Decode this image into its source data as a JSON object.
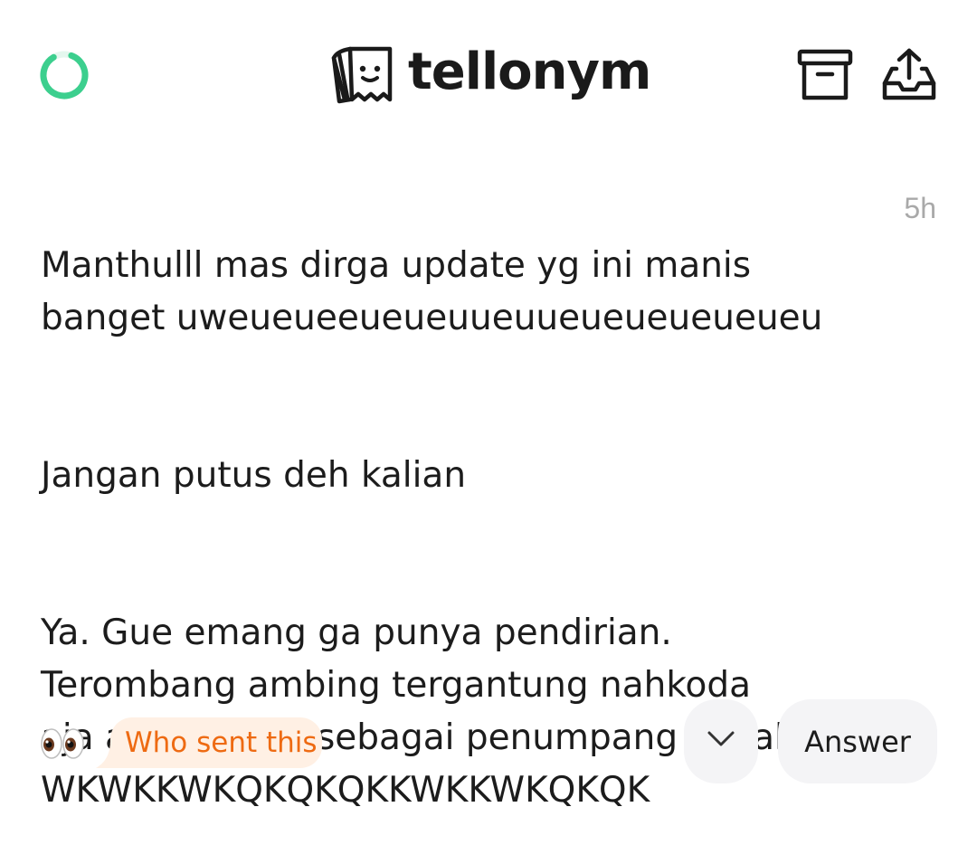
{
  "header": {
    "brand_name": "tellonym",
    "icons": {
      "progress": "loading-ring-icon",
      "logo": "tellonym-logo-icon",
      "archive": "archive-box-icon",
      "share": "share-upload-icon"
    },
    "accent_color": "#3ccf8e"
  },
  "message": {
    "timestamp": "5h",
    "paragraphs": [
      "Manthulll mas dirga update yg ini manis\nbanget uweueueeueueuueuueueueueueueu",
      "Jangan putus deh kalian",
      "Ya. Gue emang ga punya pendirian.\nTerombang ambing tergantung nahkoda\naja aku sih yaa sebagai penumpang kapal\nWKWKKWKQKQKQKKWKKWKQKQK"
    ]
  },
  "actions": {
    "eyes_emoji": "👀",
    "who_sent_label": "Who sent this",
    "who_sent_color": "#ee6a12",
    "who_sent_bg": "#fff0e4",
    "more_icon": "chevron-down-icon",
    "answer_label": "Answer"
  }
}
